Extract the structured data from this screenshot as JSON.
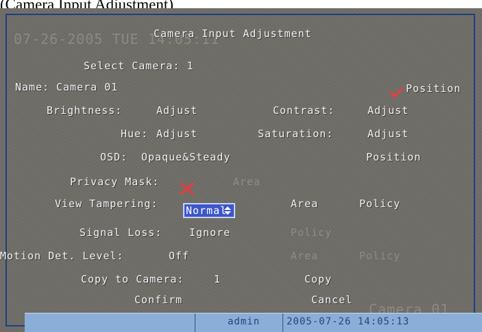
{
  "caption": "(Camera Input Adjustment)",
  "overlay": {
    "timestamp": "07-26-2005 TUE 14:05:11",
    "camera_name": "Camera 01"
  },
  "dialog": {
    "title": "Camera Input Adjustment",
    "select_camera": "Select Camera: 1",
    "name_label": "Name:",
    "name_value": "Camera 01",
    "name_position": "Position",
    "brightness_label": "Brightness:",
    "brightness_adjust": "Adjust",
    "contrast_label": "Contrast:",
    "contrast_adjust": "Adjust",
    "hue_label": "Hue:",
    "hue_adjust": "Adjust",
    "saturation_label": "Saturation:",
    "saturation_adjust": "Adjust",
    "osd_label": "OSD:",
    "osd_value": "Opaque&Steady",
    "osd_position": "Position",
    "privacy_mask_label": "Privacy Mask:",
    "privacy_area": "Area",
    "view_tampering_label": "View Tampering:",
    "view_tampering_value": "Normal",
    "view_tampering_area": "Area",
    "view_tampering_policy": "Policy",
    "signal_loss_label": "Signal Loss:",
    "signal_loss_value": "Ignore",
    "signal_loss_policy": "Policy",
    "motion_label": "Motion Det. Level:",
    "motion_value": "Off",
    "motion_area": "Area",
    "motion_policy": "Policy",
    "copy_label": "Copy to Camera:",
    "copy_value": "1",
    "copy_button": "Copy",
    "confirm_button": "Confirm",
    "cancel_button": "Cancel"
  },
  "statusbar": {
    "user": "admin",
    "datetime": "2005-07-26 14:05:13"
  },
  "colors": {
    "screen_bg": "#6f6d66",
    "text": "#f2f2f2",
    "disabled_text": "#8c8c86",
    "check": "#e04040",
    "select_bg": "#3d57c9",
    "statusbar_bg": "#8aaed8"
  },
  "icons": {
    "name_position_check": "checkmark-icon",
    "privacy_mask_toggle": "x-mark-icon",
    "select_arrows": "up-down-arrows-icon"
  }
}
